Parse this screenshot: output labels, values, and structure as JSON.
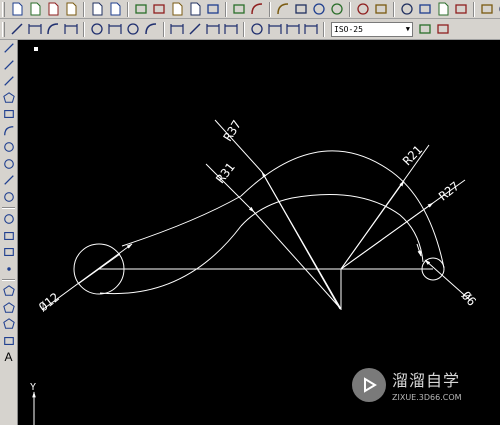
{
  "toolbars": {
    "standard": [
      "new-icon",
      "open-icon",
      "save-icon",
      "print-icon",
      "print-preview-icon",
      "publish-icon",
      "3d-dwf-icon",
      "cut-icon",
      "copy-icon",
      "paste-icon",
      "match-properties-icon",
      "block-editor-icon",
      "undo-icon",
      "redo-icon",
      "pan-icon",
      "zoom-realtime-icon",
      "zoom-window-icon",
      "zoom-previous-icon",
      "properties-icon",
      "design-center-icon",
      "tool-palettes-icon",
      "sheet-set-icon",
      "markup-icon",
      "quickcalc-icon",
      "help-icon"
    ],
    "dimension": [
      "linear-dim-icon",
      "aligned-dim-icon",
      "arc-length-icon",
      "ordinate-icon",
      "radius-dim-icon",
      "jogged-icon",
      "diameter-dim-icon",
      "angular-dim-icon",
      "quick-dim-icon",
      "baseline-icon",
      "continue-icon",
      "tolerance-icon",
      "center-mark-icon",
      "dim-edit-icon",
      "dim-text-edit-icon",
      "dim-update-icon"
    ],
    "dim_style": "ISO-25",
    "layer_tools": [
      "layers-icon",
      "layer-state-icon"
    ]
  },
  "draw_toolbar": [
    "line-icon",
    "construction-line-icon",
    "polyline-icon",
    "polygon-icon",
    "rectangle-icon",
    "arc-icon",
    "circle-icon",
    "revision-cloud-icon",
    "spline-icon",
    "ellipse-icon",
    "ellipse-arc-icon",
    "insert-block-icon",
    "make-block-icon",
    "point-icon",
    "hatch-icon",
    "gradient-icon",
    "region-icon",
    "table-icon"
  ],
  "draw_toolbar_text_button": "A",
  "drawing": {
    "dimensions": {
      "r37": "R37",
      "r31": "R31",
      "r21": "R21",
      "r27": "R27",
      "d12": "Ø12",
      "d6": "Ø6"
    },
    "ucs_y_label": "Y"
  },
  "watermark": {
    "title": "溜溜自学",
    "url": "ZIXUE.3D66.COM"
  },
  "colors": {
    "canvas": "#000000",
    "geometry": "#ffffff",
    "toolbar": "#d6d3ce"
  }
}
